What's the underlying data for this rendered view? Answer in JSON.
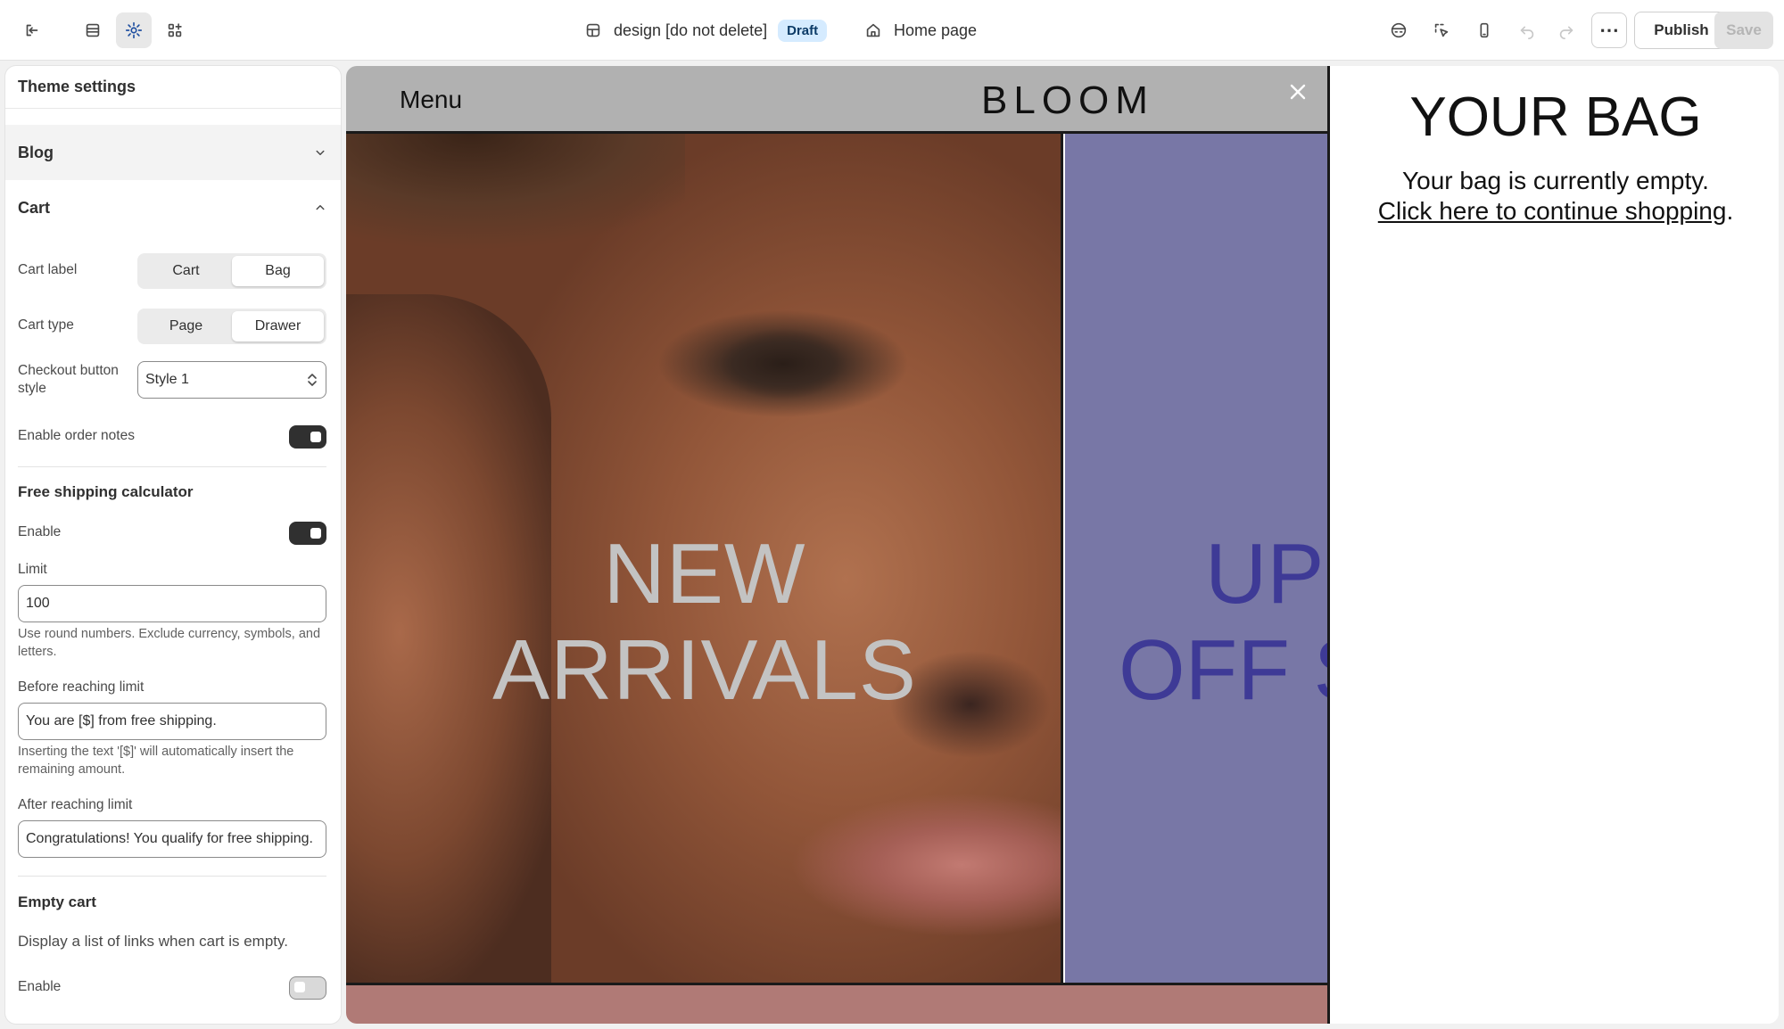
{
  "topbar": {
    "theme_name": "design [do not delete]",
    "status_badge": "Draft",
    "page_name": "Home page",
    "publish_label": "Publish",
    "save_label": "Save",
    "more_label": "⋯",
    "icons": [
      "exit-icon",
      "sections-icon",
      "theme-settings-icon",
      "app-blocks-icon",
      "theme-icon",
      "home-icon",
      "preview-mode-icon",
      "inspector-icon",
      "mobile-view-icon",
      "undo-icon",
      "redo-icon"
    ]
  },
  "sidebar": {
    "title": "Theme settings",
    "blog_section": {
      "label": "Blog",
      "expanded": false
    },
    "cart_section": {
      "label": "Cart",
      "expanded": true,
      "cart_label": {
        "label": "Cart label",
        "options": [
          "Cart",
          "Bag"
        ],
        "selected": "Bag"
      },
      "cart_type": {
        "label": "Cart type",
        "options": [
          "Page",
          "Drawer"
        ],
        "selected": "Drawer"
      },
      "checkout_button_style": {
        "label": "Checkout button style",
        "value": "Style 1"
      },
      "enable_order_notes": {
        "label": "Enable order notes",
        "on": true
      }
    },
    "free_shipping": {
      "heading": "Free shipping calculator",
      "enable": {
        "label": "Enable",
        "on": true
      },
      "limit": {
        "label": "Limit",
        "value": "100",
        "help": "Use round numbers. Exclude currency, symbols, and letters."
      },
      "before": {
        "label": "Before reaching limit",
        "value": "You are [$] from free shipping.",
        "help": "Inserting the text '[$]' will automatically insert the remaining amount."
      },
      "after": {
        "label": "After reaching limit",
        "value": "Congratulations! You qualify for free shipping."
      }
    },
    "empty_cart": {
      "heading": "Empty cart",
      "description": "Display a list of links when cart is empty.",
      "enable": {
        "label": "Enable",
        "on": false
      }
    }
  },
  "preview": {
    "menu_label": "Menu",
    "logo": "BLOOM",
    "hero_left_line1": "NEW",
    "hero_left_line2": "ARRIVALS",
    "hero_right_line1": "UP",
    "hero_right_line2": "OFF S",
    "drawer": {
      "title": "YOUR BAG",
      "empty_text": "Your bag is currently empty.",
      "continue_link": "Click here to continue shopping",
      "continue_suffix": "."
    },
    "colors": {
      "header_bg": "#b1b1b1",
      "hero_right_bg": "#7877a6",
      "hero_right_text": "#3e3a96",
      "footer_band": "#b07a76"
    }
  }
}
